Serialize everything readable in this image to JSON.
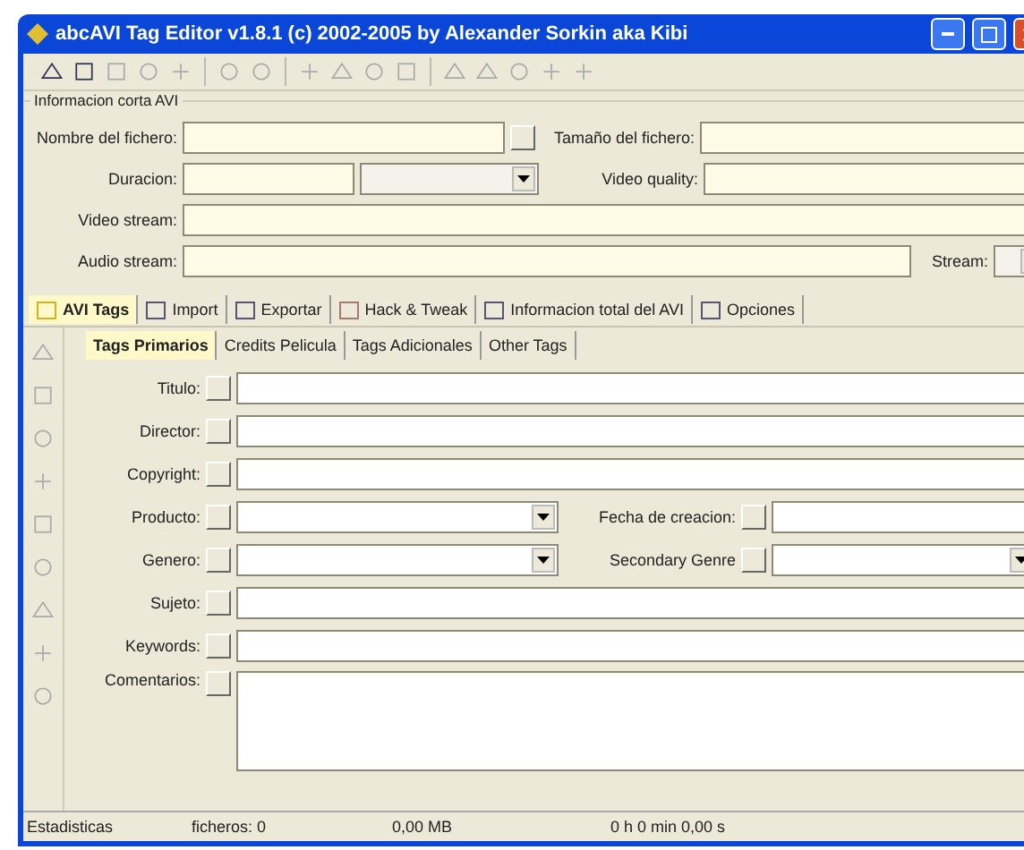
{
  "window": {
    "title": "abcAVI Tag Editor v1.8.1 (c) 2002-2005 by Alexander Sorkin aka Kibi"
  },
  "info_group": {
    "title": "Informacion corta AVI",
    "rows": [
      {
        "label": "Nombre del fichero:",
        "kind": "pair",
        "second_label": "Tamaño del fichero:"
      },
      {
        "label": "Duracion:",
        "kind": "combo_pair",
        "second_label": "Video quality:"
      },
      {
        "label": "Video stream:",
        "kind": "text"
      },
      {
        "label": "Audio stream:",
        "kind": "stream",
        "second_label": "Stream:"
      }
    ]
  },
  "main_tabs": [
    {
      "label": "AVI Tags",
      "selected": true
    },
    {
      "label": "Import",
      "selected": false
    },
    {
      "label": "Exportar",
      "selected": false
    },
    {
      "label": "Hack & Tweak",
      "selected": false
    },
    {
      "label": "Informacion total del AVI",
      "selected": false
    },
    {
      "label": "Opciones",
      "selected": false
    }
  ],
  "sub_tabs": [
    {
      "label": "Tags Primarios",
      "selected": true
    },
    {
      "label": "Credits Pelicula",
      "selected": false
    },
    {
      "label": "Tags Adicionales",
      "selected": false
    },
    {
      "label": "Other Tags",
      "selected": false
    }
  ],
  "tag_rows": [
    {
      "label": "Titulo:",
      "kind": "text"
    },
    {
      "label": "Director:",
      "kind": "text"
    },
    {
      "label": "Copyright:",
      "kind": "text"
    },
    {
      "label": "Producto:",
      "kind": "combo_pair",
      "second": {
        "label": "Fecha de creacion:",
        "kind": "text"
      }
    },
    {
      "label": "Genero:",
      "kind": "combo_pair",
      "second": {
        "label": "Secondary Genre",
        "kind": "combo"
      }
    },
    {
      "label": "Sujeto:",
      "kind": "text"
    },
    {
      "label": "Keywords:",
      "kind": "text"
    },
    {
      "label": "Comentarios:",
      "kind": "memo"
    }
  ],
  "status_bar": [
    "Estadisticas",
    "ficheros: 0",
    "0,00 MB",
    "0 h 0 min 0,00 s"
  ]
}
